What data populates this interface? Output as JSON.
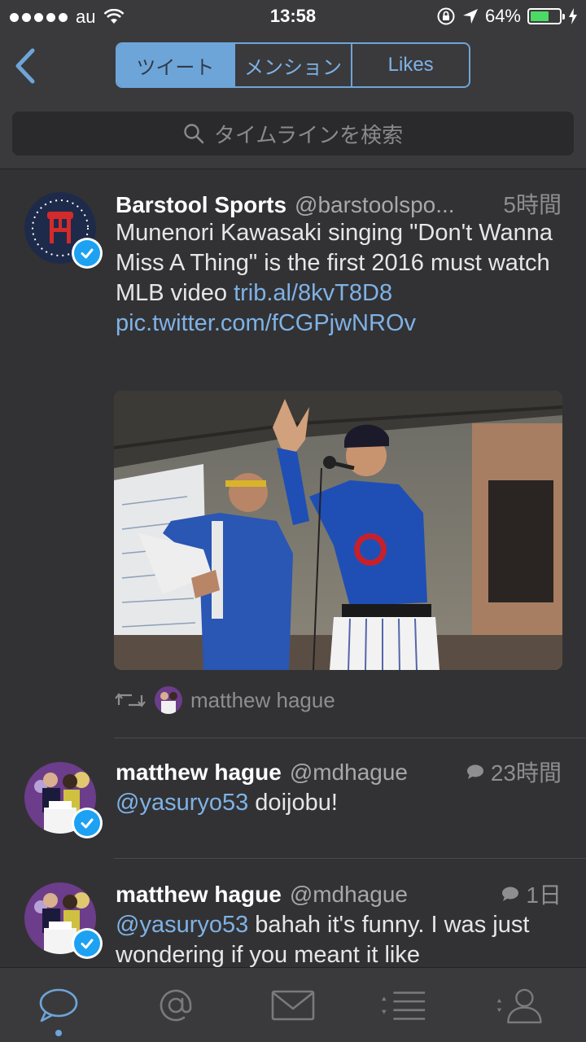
{
  "status_bar": {
    "carrier": "au",
    "time": "13:58",
    "battery": "64%",
    "battery_level": 0.64
  },
  "nav": {
    "tabs": [
      "ツイート",
      "メンション",
      "Likes"
    ],
    "selected": 0
  },
  "search": {
    "placeholder": "タイムラインを検索"
  },
  "tweets": [
    {
      "name": "Barstool Sports",
      "handle": "@barstoolspo...",
      "time": "5時間",
      "text_plain": "Munenori Kawasaki singing \"Don't Wanna Miss A Thing\" is the first 2016 must watch MLB video ",
      "link1": "trib.al/8kvT8D8",
      "link2": "pic.twitter.com/fCGPjwNROv",
      "retweeted_by": "matthew hague"
    },
    {
      "name": "matthew hague",
      "handle": "@mdhague",
      "time": "23時間",
      "mention": "@yasuryo53",
      "text": " doijobu!"
    },
    {
      "name": "matthew hague",
      "handle": "@mdhague",
      "time": "1日",
      "mention": "@yasuryo53",
      "text": " bahah it's funny. I was just wondering if you meant it like"
    }
  ],
  "colors": {
    "accent": "#6ea5d8",
    "link": "#7fb2e6",
    "background": "#323234",
    "verified": "#1da1f2"
  },
  "tabbar": {
    "icons": [
      "speech-bubble-icon",
      "at-sign-icon",
      "envelope-icon",
      "list-icon",
      "profile-icon"
    ],
    "active": 0
  }
}
